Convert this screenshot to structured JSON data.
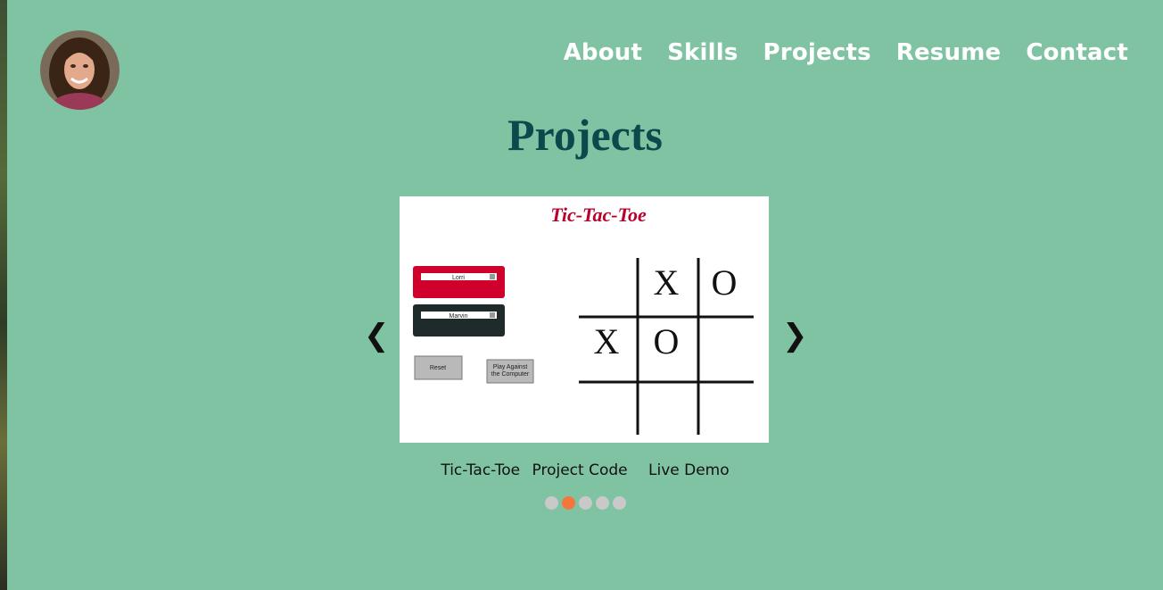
{
  "nav": {
    "items": [
      "About",
      "Skills",
      "Projects",
      "Resume",
      "Contact"
    ]
  },
  "page_title": "Projects",
  "carousel": {
    "prev_symbol": "❮",
    "next_symbol": "❯",
    "slide": {
      "screenshot_title": "Tic-Tac-Toe",
      "player1_name": "Lorri",
      "player2_name": "Marvin",
      "reset_label": "Reset",
      "play_computer_label": "Play Against\nthe Computer",
      "board": [
        [
          "",
          "X",
          "O"
        ],
        [
          "X",
          "O",
          ""
        ],
        [
          "",
          "",
          ""
        ]
      ]
    },
    "caption": {
      "project_name": "Tic-Tac-Toe",
      "code_link": "Project Code",
      "demo_link": "Live Demo"
    },
    "dot_count": 5,
    "active_dot": 1
  },
  "colors": {
    "background": "#80c3a3",
    "title": "#0b4a4c",
    "active_dot": "#f5763c",
    "inactive_dot": "#c9c9c9",
    "player1_red": "#d0002c",
    "player2_dark": "#1f2a2a"
  }
}
